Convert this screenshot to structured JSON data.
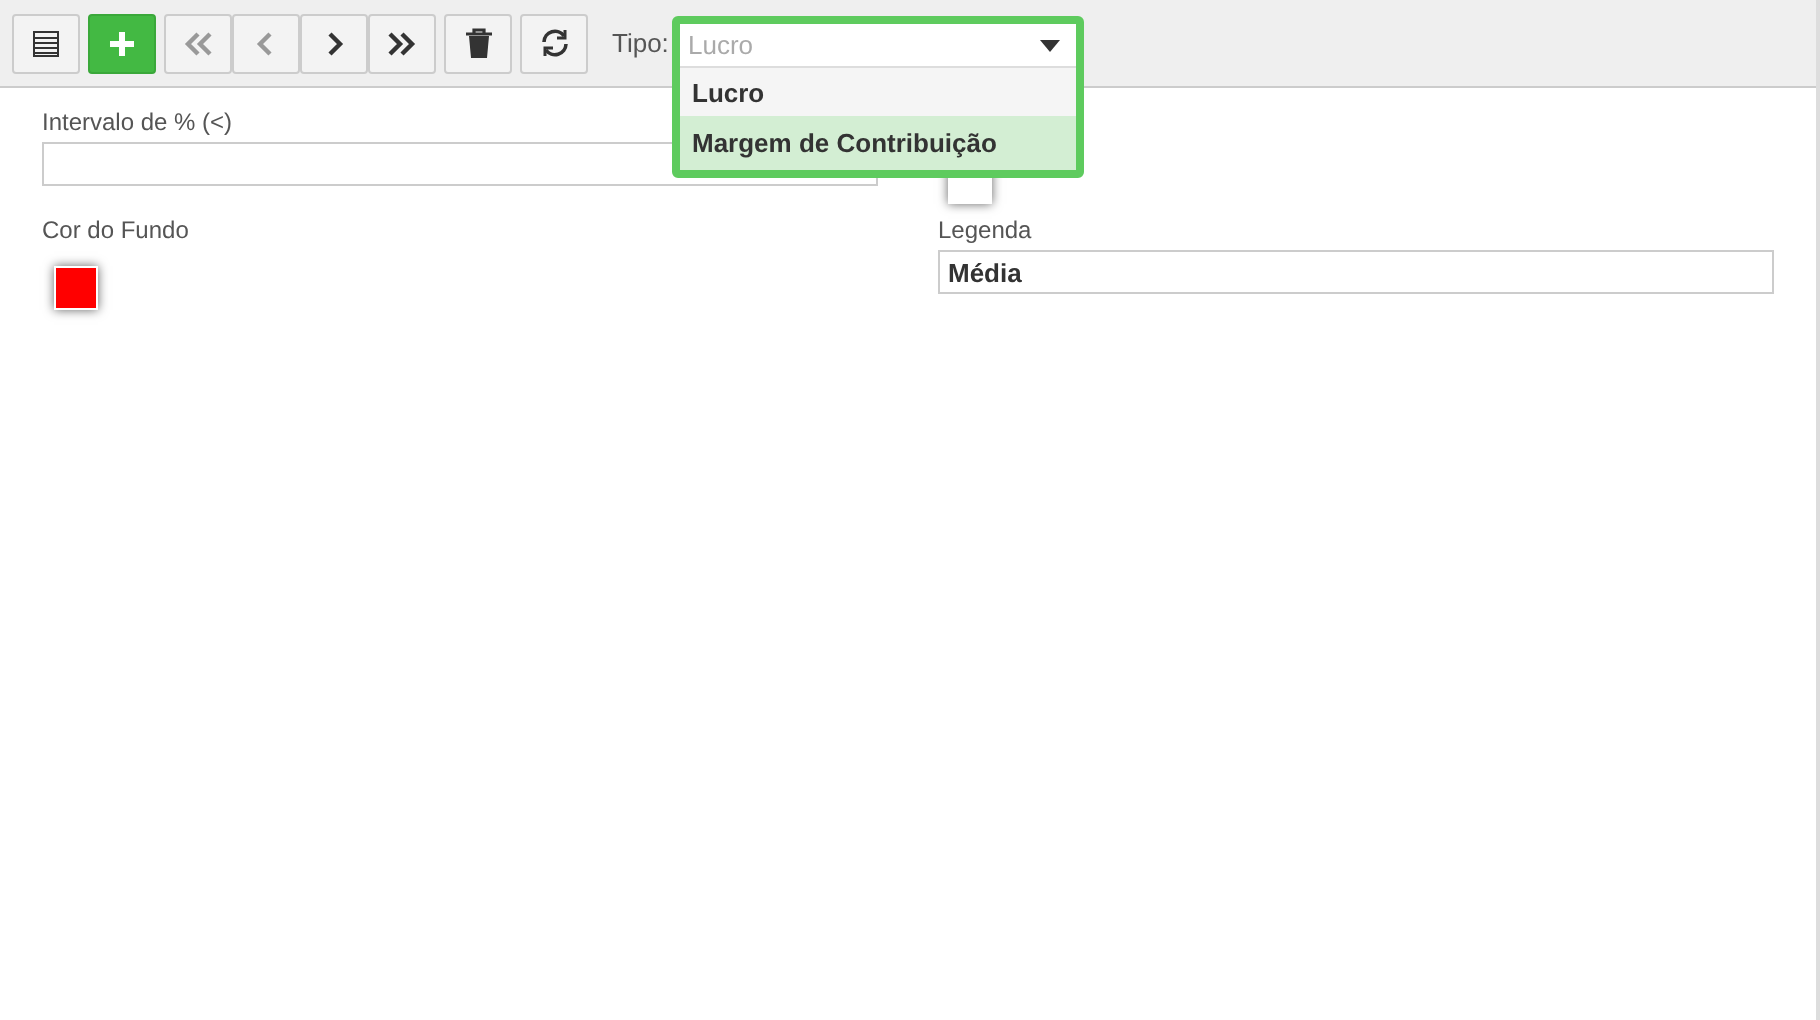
{
  "toolbar": {
    "buttons": [
      {
        "kind": "grid",
        "primary": false,
        "disabled": false
      },
      {
        "kind": "add",
        "primary": true,
        "disabled": false
      },
      {
        "kind": "first",
        "primary": false,
        "disabled": true
      },
      {
        "kind": "prev",
        "primary": false,
        "disabled": true
      },
      {
        "kind": "next",
        "primary": false,
        "disabled": false
      },
      {
        "kind": "last",
        "primary": false,
        "disabled": false
      },
      {
        "kind": "delete",
        "primary": false,
        "disabled": false
      },
      {
        "kind": "refresh",
        "primary": false,
        "disabled": false
      }
    ],
    "tipo": {
      "label": "Tipo:",
      "placeholder": "Lucro",
      "expanded": true,
      "options": [
        {
          "label": "Lucro",
          "selected": false
        },
        {
          "label": "Margem de Contribuição",
          "selected": true
        }
      ]
    }
  },
  "form": {
    "interval": {
      "label": "Intervalo de % (<)"
    },
    "text_color": {
      "color": "#ffffff"
    },
    "background": {
      "label": "Cor do Fundo",
      "color": "#ff0000"
    },
    "legend": {
      "label": "Legenda",
      "value": "Média"
    }
  }
}
